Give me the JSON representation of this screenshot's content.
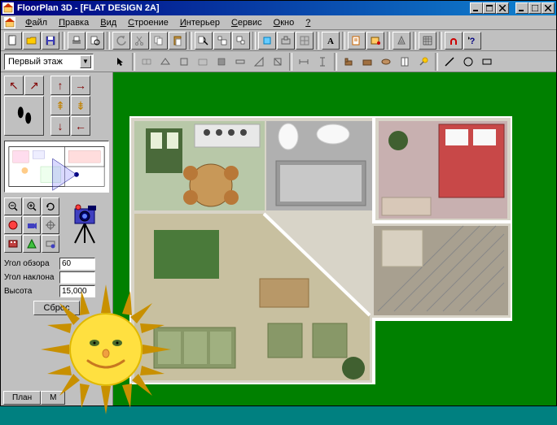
{
  "app": {
    "title": "FloorPlan 3D - [FLAT DESIGN 2A]"
  },
  "menu": {
    "items": [
      {
        "key": "Ф",
        "rest": "айл"
      },
      {
        "key": "П",
        "rest": "равка"
      },
      {
        "key": "В",
        "rest": "ид"
      },
      {
        "key": "С",
        "rest": "троение"
      },
      {
        "key": "И",
        "rest": "нтерьер"
      },
      {
        "key": "С",
        "rest": "ервис"
      },
      {
        "key": "О",
        "rest": "кно"
      },
      {
        "key": "?",
        "rest": ""
      }
    ]
  },
  "floor_selector": {
    "value": "Первый этаж"
  },
  "camera_params": {
    "view_angle_label": "Угол обзора",
    "view_angle_value": "60",
    "tilt_angle_label": "Угол наклона",
    "tilt_angle_value": "",
    "height_label": "Высота",
    "height_value": "15,000",
    "reset_label": "Сброс"
  },
  "tabs": {
    "plan": "План",
    "model": "М"
  },
  "icon_colors": {
    "nav_arrow": "#800000",
    "camera_body": "#4040c0",
    "camera_dark": "#000060"
  }
}
